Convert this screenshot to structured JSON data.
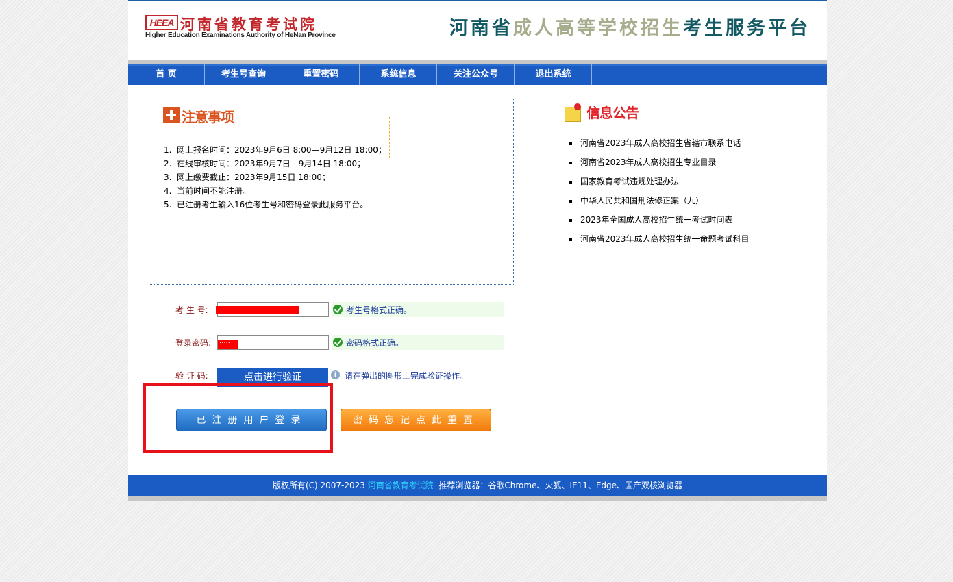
{
  "header": {
    "logo_mark": "HEEA",
    "logo_name": "河南省教育考试院",
    "logo_en": "Higher Education Examinations Authority of HeNan Province",
    "title_part1": "河南省",
    "title_part2": "成人高等学校招生",
    "title_part3": "考生服务平台"
  },
  "nav": {
    "items": [
      {
        "label": "首  页"
      },
      {
        "label": "考生号查询"
      },
      {
        "label": "重置密码"
      },
      {
        "label": "系统信息"
      },
      {
        "label": "关注公众号"
      },
      {
        "label": "退出系统"
      }
    ]
  },
  "notice": {
    "title": "注意事项",
    "items": [
      {
        "num": "1.",
        "text": "网上报名时间：2023年9月6日 8:00—9月12日 18:00；"
      },
      {
        "num": "2.",
        "text": "在线审核时间：2023年9月7日—9月14日 18:00；"
      },
      {
        "num": "3.",
        "text": "网上缴费截止：2023年9月15日 18:00；"
      },
      {
        "num": "4.",
        "text": "当前时间不能注册。"
      },
      {
        "num": "5.",
        "text": "已注册考生输入16位考生号和密码登录此服务平台。"
      }
    ]
  },
  "form": {
    "exam_no_label": "考 生 号:",
    "exam_no_hint": "考生号格式正确。",
    "password_label": "登录密码:",
    "password_value": "·····",
    "password_hint": "密码格式正确。",
    "captcha_label": "验 证 码:",
    "captcha_button": "点击进行验证",
    "captcha_hint": "请在弹出的图形上完成验证操作。",
    "login_button": "已注册用户登录",
    "reset_button": "密码忘记点此重置"
  },
  "news": {
    "title": "信息公告",
    "items": [
      {
        "text": "河南省2023年成人高校招生省辖市联系电话"
      },
      {
        "text": "河南省2023年成人高校招生专业目录"
      },
      {
        "text": "国家教育考试违规处理办法"
      },
      {
        "text": "中华人民共和国刑法修正案（九）"
      },
      {
        "text": "2023年全国成人高校招生统一考试时间表"
      },
      {
        "text": "河南省2023年成人高校招生统一命题考试科目"
      }
    ]
  },
  "footer": {
    "copyright": "版权所有(C) 2007-2023 ",
    "org_link": "河南省教育考试院",
    "browsers": "  推荐浏览器：谷歌Chrome、火狐、IE11、Edge、国产双核浏览器"
  },
  "colors": {
    "nav_blue": "#1a5bc4",
    "brand_red": "#c2262a",
    "title_teal": "#145a64",
    "title_olive": "#a6ad8c",
    "orange": "#f27a0c",
    "highlight_red": "#e8101a"
  }
}
